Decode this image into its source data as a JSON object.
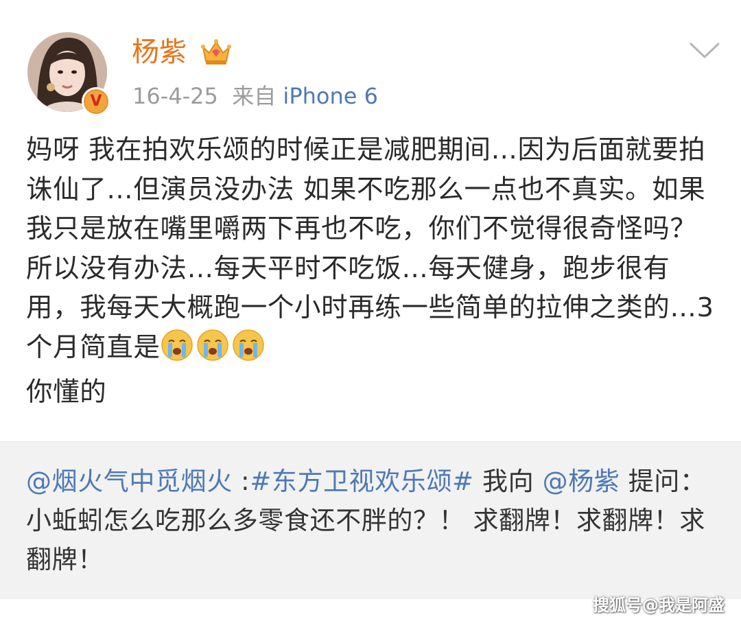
{
  "post": {
    "username": "杨紫",
    "date": "16-4-25",
    "source_prefix": "来自",
    "source_device": "iPhone 6",
    "verified_badge_text": "V",
    "text_main": "妈呀 我在拍欢乐颂的时候正是减肥期间…因为后面就要拍诛仙了…但演员没办法 如果不吃那么一点也不真实。如果我只是放在嘴里嚼两下再也不吃，你们不觉得很奇怪吗？所以没有办法…每天平时不吃饭…每天健身，跑步很有用，我每天大概跑一个小时再练一些简单的拉伸之类的…3个月简直是",
    "text_tail": "你懂的",
    "emoji": [
      "crying-face",
      "crying-face",
      "crying-face"
    ]
  },
  "repost": {
    "mention_user": "@烟火气中觅烟火",
    "separator": " :",
    "hashtag": "#东方卫视欢乐颂#",
    "text_before_mention": " 我向 ",
    "mention_target": "@杨紫",
    "text_after": " 提问：小蚯蚓怎么吃那么多零食还不胖的？！ 求翻牌！求翻牌！求翻牌！"
  },
  "watermark": "搜狐号@我是阿盛",
  "icons": {
    "crown": "crown-icon",
    "chevron": "chevron-down-icon",
    "verified": "verified-badge-icon"
  },
  "colors": {
    "username": "#e8751a",
    "link": "#4d79b6",
    "meta": "#9b9b9b",
    "text": "#2a2a2a",
    "repost_background": "#f2f2f2"
  }
}
